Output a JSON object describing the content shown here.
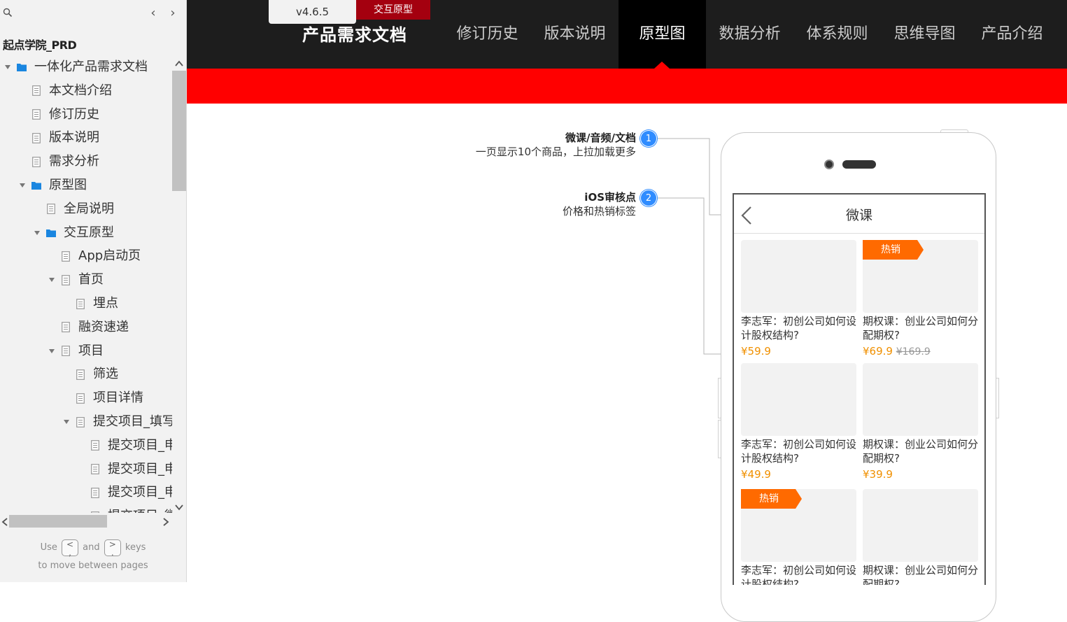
{
  "sidebar": {
    "project_name": "起点学院_PRD",
    "nav_prev": "‹",
    "nav_next": "›",
    "tree": [
      {
        "label": "一体化产品需求文档",
        "type": "folder",
        "expanded": true
      },
      {
        "label": "本文档介绍",
        "type": "page"
      },
      {
        "label": "修订历史",
        "type": "page"
      },
      {
        "label": "版本说明",
        "type": "page"
      },
      {
        "label": "需求分析",
        "type": "page"
      },
      {
        "label": "原型图",
        "type": "folder",
        "expanded": true
      },
      {
        "label": "全局说明",
        "type": "page"
      },
      {
        "label": "交互原型",
        "type": "folder",
        "expanded": true
      },
      {
        "label": "App启动页",
        "type": "page"
      },
      {
        "label": "首页",
        "type": "page",
        "expanded": true
      },
      {
        "label": "埋点",
        "type": "page"
      },
      {
        "label": "融资速递",
        "type": "page"
      },
      {
        "label": "项目",
        "type": "page",
        "expanded": true
      },
      {
        "label": "筛选",
        "type": "page"
      },
      {
        "label": "项目详情",
        "type": "page"
      },
      {
        "label": "提交项目_填写",
        "type": "page",
        "expanded": true
      },
      {
        "label": "提交项目_申",
        "type": "page"
      },
      {
        "label": "提交项目_申",
        "type": "page"
      },
      {
        "label": "提交项目_申",
        "type": "page"
      },
      {
        "label": "提交项目_微",
        "type": "page"
      }
    ],
    "hint": {
      "use": "Use",
      "and": "and",
      "keys": "keys",
      "line2": "to move between pages"
    },
    "key_prev_top": "<",
    "key_prev_bottom": ",",
    "key_next_top": ">",
    "key_next_bottom": "."
  },
  "header": {
    "version": "v4.6.5",
    "proto_tag": "交互原型",
    "doc_title": "产品需求文档",
    "nav": [
      {
        "label": "修订历史",
        "active": false
      },
      {
        "label": "版本说明",
        "active": false
      },
      {
        "label": "原型图",
        "active": true
      },
      {
        "label": "数据分析",
        "active": false
      },
      {
        "label": "体系规则",
        "active": false
      },
      {
        "label": "思维导图",
        "active": false
      },
      {
        "label": "产品介绍",
        "active": false
      }
    ]
  },
  "annotations": [
    {
      "num": "1",
      "title": "微课/音频/文档",
      "desc": "一页显示10个商品，上拉加载更多"
    },
    {
      "num": "2",
      "title": "iOS审核点",
      "desc": "价格和热销标签"
    }
  ],
  "phone": {
    "screen_title": "微课",
    "hot_label": "热销",
    "cards": [
      {
        "title": "李志军：初创公司如何设计股权结构?",
        "price": "¥59.9",
        "old_price": "",
        "hot": false
      },
      {
        "title": "期权课：创业公司如何分配期权?",
        "price": "¥69.9",
        "old_price": "¥169.9",
        "hot": true
      },
      {
        "title": "李志军：初创公司如何设计股权结构?",
        "price": "¥49.9",
        "old_price": "",
        "hot": false
      },
      {
        "title": "期权课：创业公司如何分配期权?",
        "price": "¥39.9",
        "old_price": "",
        "hot": false
      },
      {
        "title": "李志军：初创公司如何设计股权结构?",
        "price": "",
        "old_price": "",
        "hot": true
      },
      {
        "title": "期权课：创业公司如何分配期权?",
        "price": "",
        "old_price": "",
        "hot": false
      }
    ]
  },
  "colors": {
    "header_bg": "#1d1d1d",
    "accent_red": "#ff0000",
    "proto_tag_bg": "#a4000f",
    "folder_blue": "#1a86e0",
    "badge_blue": "#2f8cff",
    "price_orange": "#f09000",
    "hot_orange": "#ff6a00"
  }
}
